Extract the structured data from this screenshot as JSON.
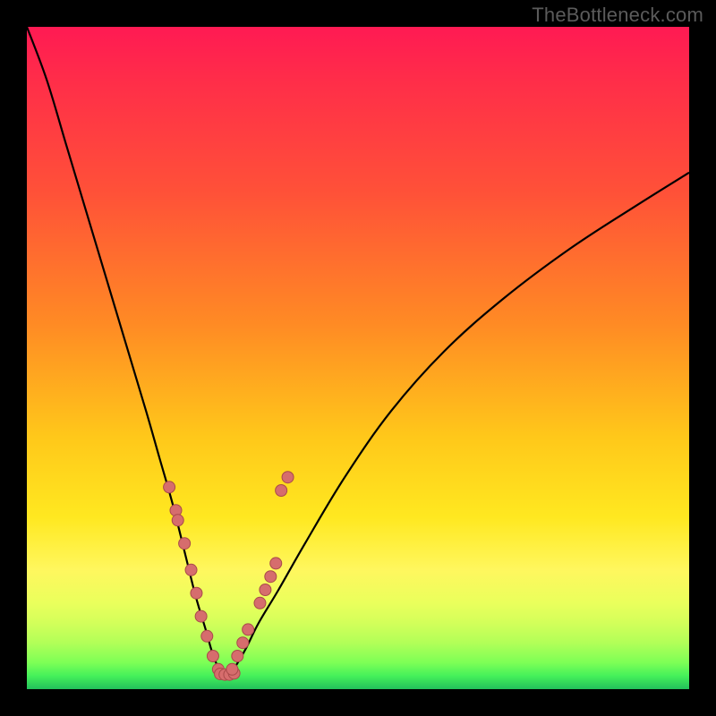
{
  "watermark": "TheBottleneck.com",
  "chart_data": {
    "type": "line",
    "title": "",
    "xlabel": "",
    "ylabel": "",
    "xlim": [
      0,
      100
    ],
    "ylim": [
      0,
      100
    ],
    "grid": false,
    "series": [
      {
        "name": "curve",
        "x": [
          0,
          3,
          6,
          9,
          12,
          15,
          18,
          20,
          22,
          24,
          25.5,
          27,
          28,
          29,
          29.6,
          30.4,
          31.2,
          33,
          35,
          38,
          42,
          48,
          55,
          63,
          72,
          82,
          92,
          100
        ],
        "y": [
          100,
          92,
          82,
          72,
          62,
          52,
          42,
          35,
          28,
          20,
          14,
          9,
          5.5,
          3,
          2.2,
          2.2,
          3,
          6,
          10,
          15,
          22,
          32,
          42,
          51,
          59,
          66.5,
          73,
          78
        ]
      }
    ],
    "markers": {
      "name": "highlight-dots",
      "left_arm": {
        "x": [
          21.5,
          22.5,
          22.8,
          23.8,
          24.8,
          25.6,
          26.3,
          27.2,
          28.1,
          28.9
        ],
        "y": [
          30.5,
          27,
          25.5,
          22,
          18,
          14.5,
          11,
          8,
          5,
          3
        ]
      },
      "right_arm": {
        "x": [
          31.0,
          31.8,
          32.6,
          33.4,
          35.2,
          36.0,
          36.8,
          37.6,
          38.4,
          39.4
        ],
        "y": [
          3,
          5,
          7,
          9,
          13,
          15,
          17,
          19,
          30,
          32
        ]
      },
      "bottom": {
        "x": [
          29.2,
          29.9,
          30.6,
          31.3
        ],
        "y": [
          2.3,
          2.2,
          2.2,
          2.4
        ]
      }
    }
  }
}
